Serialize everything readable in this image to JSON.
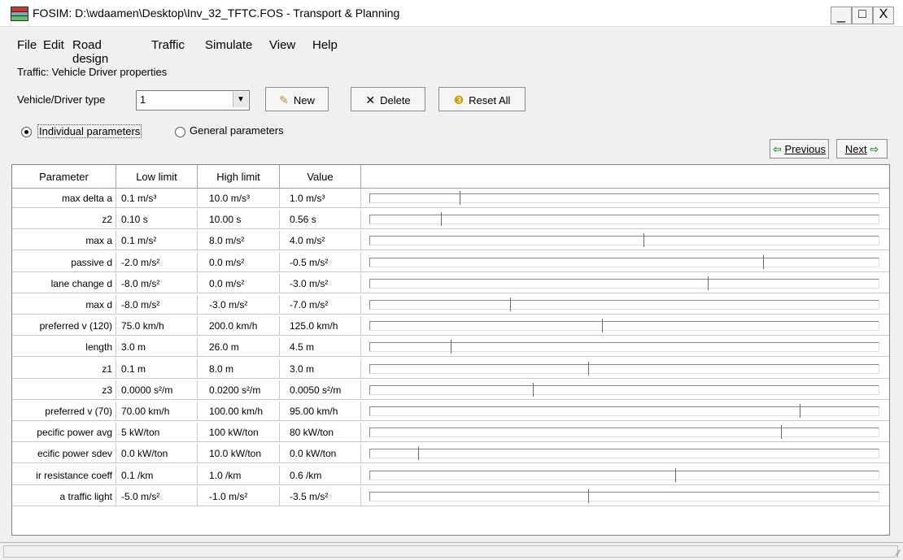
{
  "window": {
    "title": "FOSIM: D:\\wdaamen\\Desktop\\Inv_32_TFTC.FOS - Transport & Planning",
    "minimize": "_",
    "maximize": "□",
    "close": "X"
  },
  "menu": [
    {
      "label": "File"
    },
    {
      "label": "Edit"
    },
    {
      "label": "Road design"
    },
    {
      "label": "Traffic"
    },
    {
      "label": "Simulate"
    },
    {
      "label": "View"
    },
    {
      "label": "Help"
    }
  ],
  "panel": {
    "section_label": "Traffic: Vehicle Driver properties",
    "type_label": "Vehicle/Driver type",
    "type_value": "1",
    "new_label": "New",
    "delete_label": "Delete",
    "reset_label": "Reset All",
    "radio_individual": "Individual parameters",
    "radio_general": "General parameters",
    "prev_label": "Previous",
    "next_label": "Next"
  },
  "grid": {
    "headers": [
      "Parameter",
      "Low limit",
      "High limit",
      "Value"
    ],
    "rows": [
      {
        "param": "max delta a",
        "low": "0.1 m/s³",
        "high": "10.0 m/s³",
        "value": "1.0 m/s³",
        "level": 0.09
      },
      {
        "param": "z2",
        "low": "0.10 s",
        "high": "10.00 s",
        "value": "0.56 s",
        "level": 0.05
      },
      {
        "param": "max a",
        "low": "0.1 m/s²",
        "high": "8.0 m/s²",
        "value": "4.0 m/s²",
        "level": 0.49
      },
      {
        "param": "passive d",
        "low": "-2.0 m/s²",
        "high": "0.0 m/s²",
        "value": "-0.5 m/s²",
        "level": 0.75
      },
      {
        "param": "lane change d",
        "low": "-8.0 m/s²",
        "high": "0.0 m/s²",
        "value": "-3.0 m/s²",
        "level": 0.63
      },
      {
        "param": "max d",
        "low": "-8.0 m/s²",
        "high": "-3.0 m/s²",
        "value": "-7.0 m/s²",
        "level": 0.2
      },
      {
        "param": "preferred v (120)",
        "low": "75.0 km/h",
        "high": "200.0 km/h",
        "value": "125.0 km/h",
        "level": 0.4
      },
      {
        "param": "length",
        "low": "3.0 m",
        "high": "26.0 m",
        "value": "4.5 m",
        "level": 0.07
      },
      {
        "param": "z1",
        "low": "0.1 m",
        "high": "8.0 m",
        "value": "3.0 m",
        "level": 0.37
      },
      {
        "param": "z3",
        "low": "0.0000 s²/m",
        "high": "0.0200 s²/m",
        "value": "0.0050 s²/m",
        "level": 0.25
      },
      {
        "param": "preferred v (70)",
        "low": "70.00 km/h",
        "high": "100.00 km/h",
        "value": "95.00 km/h",
        "level": 0.83
      },
      {
        "param": "pecific power avg",
        "low": "5 kW/ton",
        "high": "100 kW/ton",
        "value": "80 kW/ton",
        "level": 0.79
      },
      {
        "param": "ecific power sdev",
        "low": "0.0 kW/ton",
        "high": "10.0 kW/ton",
        "value": "0.0 kW/ton",
        "level": 0.0
      },
      {
        "param": "ir resistance coeff",
        "low": "0.1 /km",
        "high": "1.0 /km",
        "value": "0.6 /km",
        "level": 0.56
      },
      {
        "param": "a traffic light",
        "low": "-5.0 m/s²",
        "high": "-1.0 m/s²",
        "value": "-3.5 m/s²",
        "level": 0.37
      }
    ]
  },
  "colors": {
    "nav_arrow": "#1a8a3a",
    "grid_border": "#828282"
  }
}
